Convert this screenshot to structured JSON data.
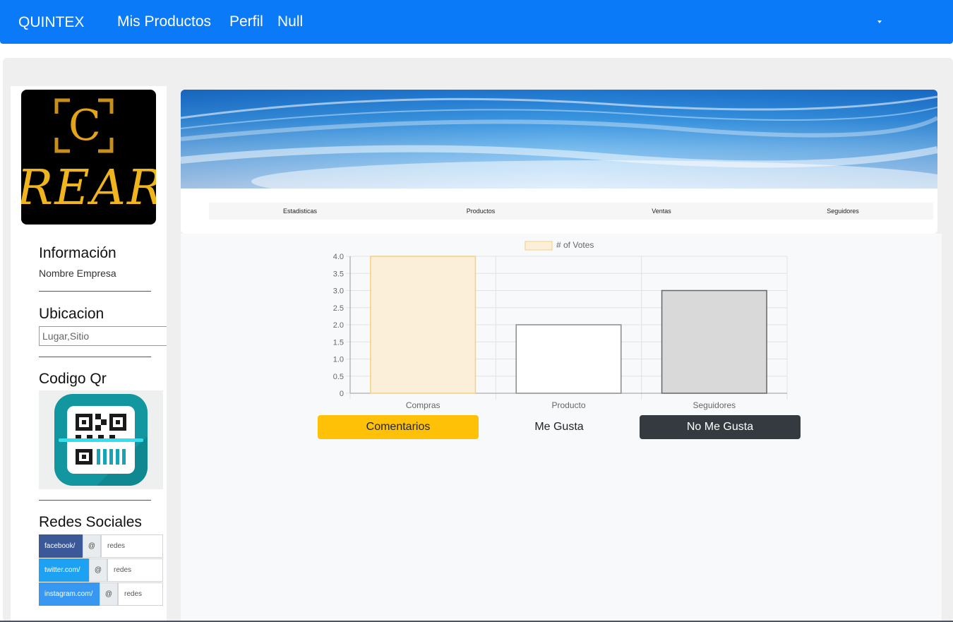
{
  "navbar": {
    "brand": "QUINTEX",
    "links": [
      "Mis Productos",
      "Perfil",
      "Null"
    ],
    "color": "#0a7af8"
  },
  "sidebar": {
    "logo": {
      "letter": "C",
      "text": "REAR"
    },
    "info_title": "Información",
    "company_name": "Nombre Empresa",
    "location_title": "Ubicacion",
    "location_placeholder": "Lugar,Sitio",
    "qr_title": "Codigo Qr",
    "qr_icon": "qr-scan-icon",
    "social_title": "Redes Sociales",
    "social": [
      {
        "label": "facebook/",
        "at": "@",
        "placeholder": "redes",
        "color": "#3b5998"
      },
      {
        "label": "twitter.com/",
        "at": "@",
        "placeholder": "redes",
        "color": "#1da1f2"
      },
      {
        "label": "instagram.com/",
        "at": "@",
        "placeholder": "redes",
        "color": "#3897f0"
      }
    ]
  },
  "tabs": [
    "Estadisticas",
    "Productos",
    "Ventas",
    "Seguidores"
  ],
  "chart_data": {
    "type": "bar",
    "legend": "# of Votes",
    "categories": [
      "Compras",
      "Producto",
      "Seguidores"
    ],
    "values": [
      4,
      2,
      3
    ],
    "ylim": [
      0,
      4
    ],
    "yticks": [
      "4.0",
      "3.5",
      "3.0",
      "2.5",
      "2.0",
      "1.5",
      "1.0",
      "0.5",
      "0"
    ],
    "bar_fill": [
      "#fbefd9",
      "#ffffff",
      "#d9d9d9"
    ],
    "bar_stroke": [
      "#f5d17f",
      "#8a8a8a",
      "#666666"
    ],
    "legend_position": "top"
  },
  "buttons": {
    "comments": "Comentarios",
    "like": "Me Gusta",
    "dislike": "No Me Gusta"
  }
}
